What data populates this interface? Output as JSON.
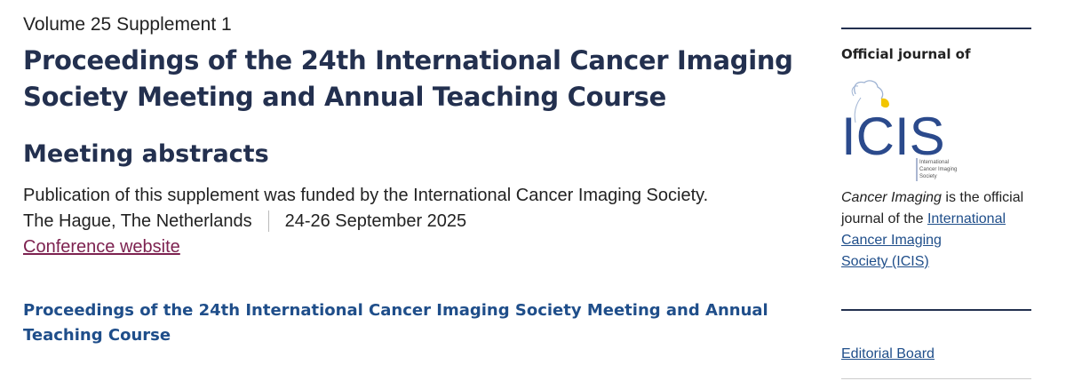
{
  "issue": {
    "volume_line": "Volume 25 Supplement 1",
    "title_line1": "Proceedings of the 24th International Cancer Imaging",
    "title_line2": "Society Meeting and Annual Teaching Course",
    "subtitle": "Meeting abstracts",
    "funding": "Publication of this supplement was funded by the International Cancer Imaging Society.",
    "location": "The Hague, The Netherlands",
    "dates": "24-26 September 2025",
    "conference_link": "Conference website",
    "article_title": "Proceedings of the 24th International Cancer Imaging Society Meeting and Annual Teaching Course"
  },
  "sidebar": {
    "official_heading": "Official journal of",
    "logo": {
      "letters": "ICIS",
      "tagline": [
        "International",
        "Cancer Imaging",
        "Society"
      ]
    },
    "description": {
      "journal_name": "Cancer Imaging",
      "text_mid": " is the official journal of the ",
      "society_link_line1": "International",
      "society_link_line2": "Cancer Imaging",
      "society_link_line3": "Society (ICIS)"
    },
    "editorial_board": "Editorial Board"
  },
  "colors": {
    "navy_heading": "#23304f",
    "link_blue": "#1f4e8a",
    "link_maroon": "#7d2250",
    "logo_blue": "#2b4a8c",
    "logo_yellow": "#f2c500"
  }
}
